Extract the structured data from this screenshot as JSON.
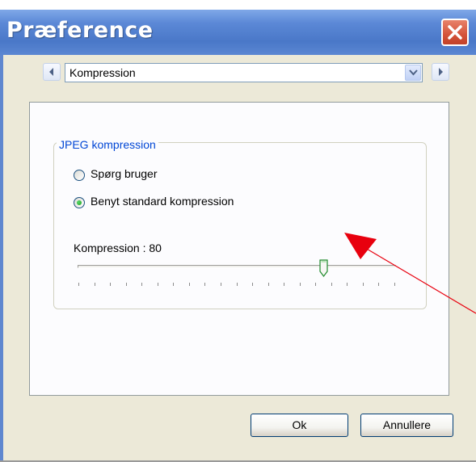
{
  "window": {
    "title": "Præference"
  },
  "nav": {
    "selected_page": "Kompression"
  },
  "group": {
    "title": "JPEG kompression"
  },
  "options": [
    {
      "label": "Spørg bruger",
      "selected": false
    },
    {
      "label": "Benyt standard kompression",
      "selected": true
    }
  ],
  "compression": {
    "label": "Kompression : 80",
    "value": 80,
    "min": 0,
    "max": 100
  },
  "buttons": {
    "ok": "Ok",
    "cancel": "Annullere"
  },
  "colors": {
    "titlebar": "#4a78c8",
    "group_title": "#0046d5",
    "annotation": "#e8000e"
  },
  "icons": [
    "close-icon",
    "chevron-left-icon",
    "chevron-right-icon",
    "chevron-down-icon",
    "slider-thumb-icon",
    "arrow-annotation-icon"
  ]
}
